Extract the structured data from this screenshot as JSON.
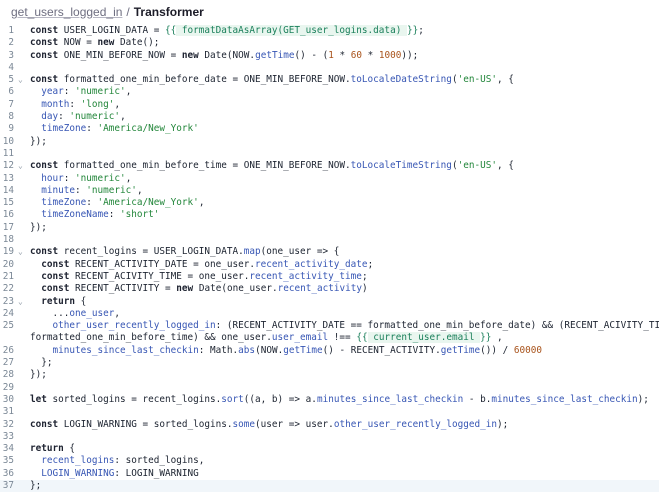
{
  "breadcrumb": {
    "parent": "get_users_logged_in",
    "separator": "/",
    "current": "Transformer"
  },
  "gutter": {
    "line_numbers": [
      "1",
      "2",
      "3",
      "4",
      "5",
      "6",
      "7",
      "8",
      "9",
      "10",
      "11",
      "12",
      "13",
      "14",
      "15",
      "16",
      "17",
      "18",
      "19",
      "20",
      "21",
      "22",
      "23",
      "24",
      "25",
      "",
      "26",
      "27",
      "28",
      "29",
      "30",
      "31",
      "32",
      "33",
      "34",
      "35",
      "36",
      "37"
    ]
  },
  "code_lines": [
    "const USER_LOGIN_DATA = {{ formatDataAsArray(GET_user_logins.data) }};",
    "const NOW = new Date();",
    "const ONE_MIN_BEFORE_NOW = new Date(NOW.getTime() - (1 * 60 * 1000));",
    "",
    "const formatted_one_min_before_date = ONE_MIN_BEFORE_NOW.toLocaleDateString('en-US', {",
    "  year: 'numeric',",
    "  month: 'long',",
    "  day: 'numeric',",
    "  timeZone: 'America/New_York'",
    "});",
    "",
    "const formatted_one_min_before_time = ONE_MIN_BEFORE_NOW.toLocaleTimeString('en-US', {",
    "  hour: 'numeric',",
    "  minute: 'numeric',",
    "  timeZone: 'America/New_York',",
    "  timeZoneName: 'short'",
    "});",
    "",
    "const recent_logins = USER_LOGIN_DATA.map(one_user => {",
    "  const RECENT_ACTIVITY_DATE = one_user.recent_activity_date;",
    "  const RECENT_ACIVITY_TIME = one_user.recent_activity_time;",
    "  const RECENT_ACTIVITY = new Date(one_user.recent_activity)",
    "  return {",
    "    ...one_user,",
    "    other_user_recently_logged_in: (RECENT_ACTIVITY_DATE == formatted_one_min_before_date) && (RECENT_ACIVITY_TIME >",
    "formatted_one_min_before_time) && one_user.user_email !== {{ current_user.email }} ,",
    "    minutes_since_last_checkin: Math.abs(NOW.getTime() - RECENT_ACTIVITY.getTime()) / 60000",
    "  };",
    "});",
    "",
    "let sorted_logins = recent_logins.sort((a, b) => a.minutes_since_last_checkin - b.minutes_since_last_checkin);",
    "",
    "const LOGIN_WARNING = sorted_logins.some(user => user.other_user_recently_logged_in);",
    "",
    "return {",
    "  recent_logins: sorted_logins,",
    "  LOGIN_WARNING: LOGIN_WARNING",
    "};"
  ],
  "syntax_colors": {
    "keyword": "#1d2230",
    "string": "#22863a",
    "number": "#a8521a",
    "property": "#3756b4",
    "template": "#1a7f5a",
    "line_number": "#7b8896"
  },
  "fold_markers": {
    "icon": "chevron-down-icon",
    "glyph": "⌄"
  }
}
